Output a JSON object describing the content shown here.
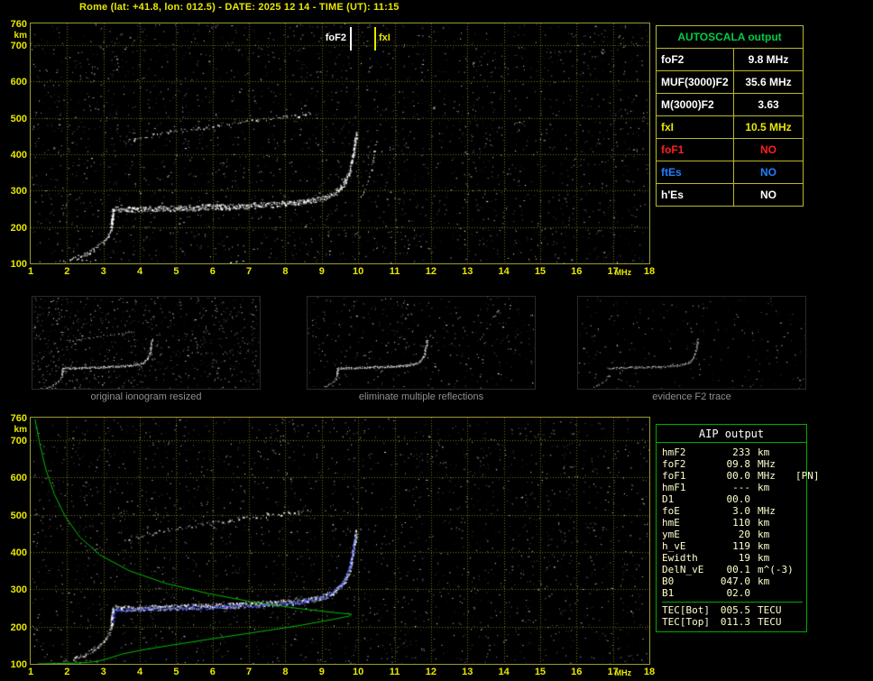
{
  "title": "Rome (lat: +41.8, lon: 012.5) - DATE: 2025 12 14 - TIME (UT): 11:15",
  "colors": {
    "accent_yellow": "#e8e800",
    "grid": "#70701a",
    "autoscala_header_green": "#00cc44",
    "table_border_yellow": "#b8b830",
    "aip_border_green": "#00aa00",
    "profile_green": "#00bb00",
    "restored_blue": "#4455ff",
    "caption_gray": "#909090",
    "white": "#ffffff",
    "no_red": "#ff2020",
    "no_blue": "#2080ff"
  },
  "top_plot": {
    "y_unit": "km",
    "y_ticks": [
      760,
      700,
      600,
      500,
      400,
      300,
      200,
      100
    ],
    "x_ticks": [
      1,
      2,
      3,
      4,
      5,
      6,
      7,
      8,
      9,
      10,
      11,
      12,
      13,
      14,
      15,
      16,
      17,
      18
    ],
    "x_unit": "MHz",
    "markers": {
      "foF2": {
        "label": "foF2",
        "freq": 9.78,
        "color": "#ffffff"
      },
      "fxI": {
        "label": "fxI",
        "freq": 10.45,
        "color": "#e8e800"
      }
    }
  },
  "bottom_plot": {
    "y_unit": "km",
    "y_ticks": [
      760,
      700,
      600,
      500,
      400,
      300,
      200,
      100
    ],
    "x_ticks": [
      1,
      2,
      3,
      4,
      5,
      6,
      7,
      8,
      9,
      10,
      11,
      12,
      13,
      14,
      15,
      16,
      17,
      18
    ],
    "x_unit": "MHz"
  },
  "autoscala": {
    "header": "AUTOSCALA output",
    "rows": [
      {
        "param": "foF2",
        "value": "9.8 MHz",
        "color": "#ffffff"
      },
      {
        "param": "MUF(3000)F2",
        "value": "35.6 MHz",
        "color": "#ffffff"
      },
      {
        "param": "M(3000)F2",
        "value": "3.63",
        "color": "#ffffff"
      },
      {
        "param": "fxI",
        "value": "10.5 MHz",
        "color": "#e8e800"
      },
      {
        "param": "foF1",
        "value": "NO",
        "color": "#ff2020"
      },
      {
        "param": "ftEs",
        "value": "NO",
        "color": "#2080ff"
      },
      {
        "param": "h'Es",
        "value": "NO",
        "color": "#ffffff"
      }
    ]
  },
  "thumbnails": [
    {
      "caption": "original ionogram resized"
    },
    {
      "caption": "eliminate multiple reflections"
    },
    {
      "caption": "evidence F2 trace"
    }
  ],
  "aip": {
    "header": "AIP output",
    "rows": [
      {
        "param": "hmF2",
        "value": "233",
        "unit": "km",
        "extra": ""
      },
      {
        "param": "foF2",
        "value": "09.8",
        "unit": "MHz",
        "extra": ""
      },
      {
        "param": "foF1",
        "value": "00.0",
        "unit": "MHz",
        "extra": "[PN]"
      },
      {
        "param": "hmF1",
        "value": "---",
        "unit": "km",
        "extra": ""
      },
      {
        "param": "D1",
        "value": "00.0",
        "unit": "",
        "extra": ""
      },
      {
        "param": "foE",
        "value": "3.0",
        "unit": "MHz",
        "extra": ""
      },
      {
        "param": "hmE",
        "value": "110",
        "unit": "km",
        "extra": ""
      },
      {
        "param": "ymE",
        "value": "20",
        "unit": "km",
        "extra": ""
      },
      {
        "param": "h_vE",
        "value": "119",
        "unit": "km",
        "extra": ""
      },
      {
        "param": "Ewidth",
        "value": "19",
        "unit": "km",
        "extra": ""
      },
      {
        "param": "DelN_vE",
        "value": "00.1",
        "unit": "m^(-3)",
        "extra": ""
      },
      {
        "param": "B0",
        "value": "047.0",
        "unit": "km",
        "extra": ""
      },
      {
        "param": "B1",
        "value": "02.0",
        "unit": "",
        "extra": ""
      },
      {
        "param": "TEC[Bot]",
        "value": "005.5",
        "unit": "TECU",
        "extra": "",
        "sep": true
      },
      {
        "param": "TEC[Top]",
        "value": "011.3",
        "unit": "TECU",
        "extra": ""
      }
    ]
  },
  "chart_data": {
    "type": "scatter",
    "title": "Ionogram with AUTOSCALA scaling and AIP electron density profile",
    "xlabel": "MHz",
    "ylabel": "km",
    "x_range": [
      1,
      18
    ],
    "y_range": [
      100,
      760
    ],
    "grid": true,
    "traces": {
      "lf_tail": {
        "color": "#ffffff",
        "spread": 4,
        "density": 0.9,
        "points": [
          [
            2.15,
            112
          ],
          [
            2.45,
            124
          ],
          [
            2.75,
            142
          ],
          [
            3.0,
            160
          ],
          [
            3.12,
            178
          ],
          [
            3.2,
            198
          ]
        ]
      },
      "cusp": {
        "color": "#ffffff",
        "spread": 3,
        "density": 2.5,
        "points": [
          [
            3.2,
            198
          ],
          [
            3.26,
            252
          ]
        ]
      },
      "f2": {
        "color": "#ffffff",
        "spread": 6,
        "density": 2.0,
        "points": [
          [
            3.3,
            251
          ],
          [
            3.8,
            249
          ],
          [
            4.6,
            252
          ],
          [
            5.6,
            255
          ],
          [
            6.6,
            258
          ],
          [
            7.6,
            263
          ],
          [
            8.4,
            269
          ],
          [
            9.0,
            279
          ],
          [
            9.35,
            294
          ],
          [
            9.6,
            320
          ],
          [
            9.75,
            352
          ],
          [
            9.83,
            390
          ],
          [
            9.9,
            430
          ],
          [
            9.94,
            458
          ]
        ]
      },
      "second_hop": {
        "color": "#ffffff",
        "spread": 4,
        "density": 0.35,
        "points": [
          [
            3.6,
            437
          ],
          [
            4.3,
            452
          ],
          [
            5.2,
            468
          ],
          [
            6.2,
            482
          ],
          [
            7.2,
            495
          ],
          [
            8.2,
            507
          ],
          [
            8.7,
            513
          ]
        ]
      },
      "x_mode_rise": {
        "color": "#ffffff",
        "spread": 4,
        "density": 0.3,
        "points": [
          [
            10.05,
            280
          ],
          [
            10.25,
            320
          ],
          [
            10.4,
            380
          ],
          [
            10.5,
            445
          ]
        ]
      },
      "e_echoes": {
        "color": "#ffffff",
        "spread": 3,
        "density": 0.25,
        "points": [
          [
            1.6,
            106
          ],
          [
            2.2,
            109
          ],
          [
            2.8,
            107
          ]
        ]
      },
      "restored": {
        "color": "#4455ff",
        "spread": 4,
        "density": 1.1,
        "points": [
          [
            3.25,
            215
          ],
          [
            3.3,
            245
          ],
          [
            4.2,
            248
          ],
          [
            5.4,
            251
          ],
          [
            6.6,
            255
          ],
          [
            7.8,
            261
          ],
          [
            8.7,
            270
          ],
          [
            9.25,
            288
          ],
          [
            9.55,
            315
          ],
          [
            9.75,
            355
          ],
          [
            9.85,
            405
          ],
          [
            9.9,
            445
          ]
        ]
      }
    },
    "profile": {
      "color": "#00bb00",
      "points": [
        [
          1.12,
          756
        ],
        [
          1.25,
          690
        ],
        [
          1.42,
          620
        ],
        [
          1.65,
          555
        ],
        [
          1.95,
          495
        ],
        [
          2.35,
          440
        ],
        [
          2.9,
          392
        ],
        [
          3.7,
          350
        ],
        [
          4.7,
          316
        ],
        [
          5.9,
          288
        ],
        [
          7.2,
          264
        ],
        [
          8.4,
          248
        ],
        [
          9.3,
          238
        ],
        [
          9.75,
          233.5
        ],
        [
          9.82,
          233
        ],
        [
          9.75,
          228
        ],
        [
          9.3,
          219
        ],
        [
          8.4,
          203
        ],
        [
          7.2,
          185
        ],
        [
          5.9,
          166
        ],
        [
          4.8,
          149
        ],
        [
          4.0,
          136
        ],
        [
          3.5,
          126
        ],
        [
          3.25,
          118
        ],
        [
          3.05,
          112
        ],
        [
          2.9,
          108
        ],
        [
          2.6,
          104
        ],
        [
          2.2,
          102
        ],
        [
          1.7,
          101
        ],
        [
          1.2,
          100
        ]
      ]
    }
  }
}
